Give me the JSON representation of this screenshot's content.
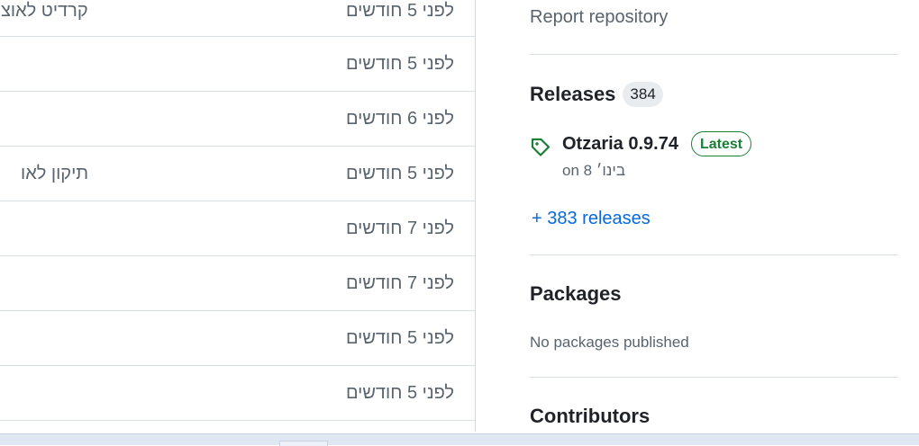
{
  "file_list": {
    "rows": [
      {
        "message": "קרדיט לאוצ",
        "time": "לפני 5 חודשים"
      },
      {
        "message": "",
        "time": "לפני 5 חודשים"
      },
      {
        "message": "",
        "time": "לפני 6 חודשים"
      },
      {
        "message": "תיקון לאו",
        "time": "לפני 5 חודשים"
      },
      {
        "message": "",
        "time": "לפני 7 חודשים"
      },
      {
        "message": "",
        "time": "לפני 7 חודשים"
      },
      {
        "message": "",
        "time": "לפני 5 חודשים"
      },
      {
        "message": "",
        "time": "לפני 5 חודשים"
      }
    ]
  },
  "sidebar": {
    "report_label": "Report repository",
    "releases": {
      "title": "Releases",
      "count": "384",
      "latest": {
        "name": "Otzaria 0.9.74",
        "badge": "Latest",
        "date": "on בינו׳ 8",
        "icon": "tag-icon"
      },
      "more_label": "+ 383 releases"
    },
    "packages": {
      "title": "Packages",
      "empty_label": "No packages published"
    },
    "contributors": {
      "title": "Contributors"
    }
  },
  "colors": {
    "link": "#0969da",
    "muted": "#59636e",
    "success": "#1a7f37",
    "border": "#d8dee4"
  }
}
